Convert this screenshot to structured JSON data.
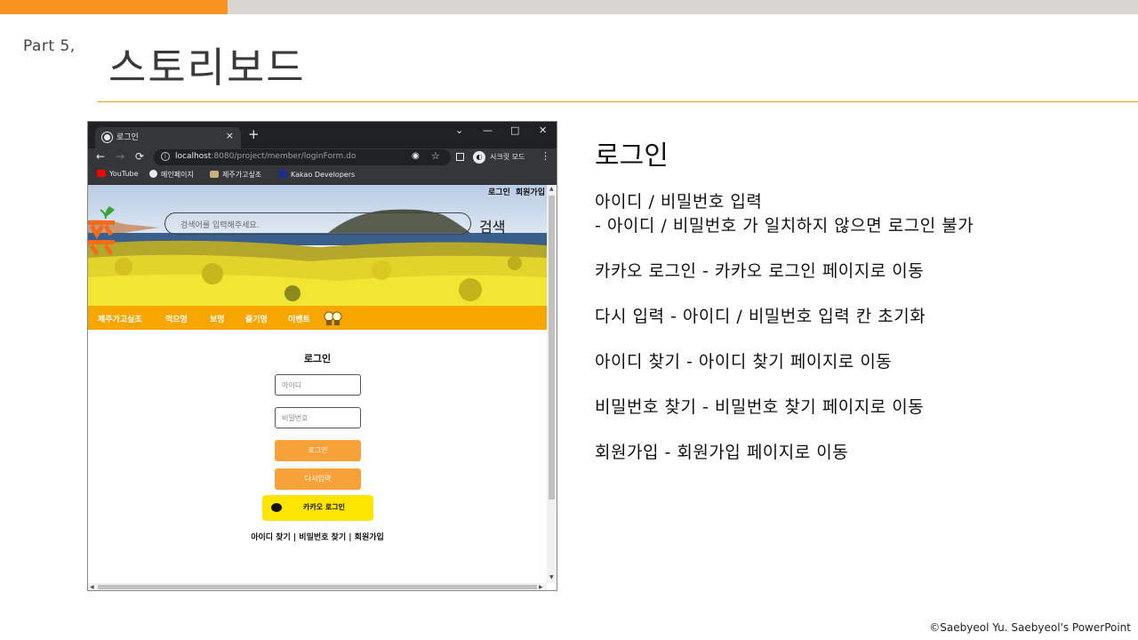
{
  "slide": {
    "part_label": "Part  5,",
    "title": "스토리보드",
    "footer": "©Saebyeol Yu. Saebyeol's PowerPoint",
    "colors": {
      "accent": "#f7931e",
      "rule": "#d8a600",
      "nav": "#f7a600",
      "kakao": "#fee500"
    }
  },
  "browser": {
    "tab_title": "로그인",
    "tab_close": "×",
    "new_tab": "+",
    "window_controls": {
      "dropdown": "⌄",
      "minimize": "—",
      "maximize": "□",
      "close": "✕"
    },
    "nav": {
      "back": "←",
      "forward": "→",
      "reload": "⟳"
    },
    "url_host": "localhost",
    "url_path": ":8080/project/member/loginForm.do",
    "incognito_label": "시크릿 모드",
    "menu": "⋮",
    "bookmarks": [
      {
        "label": "YouTube",
        "icon": "youtube-icon",
        "color": "#ff0000"
      },
      {
        "label": "메인페이지",
        "icon": "globe-icon",
        "color": "#e8eaed"
      },
      {
        "label": "제주가고싶조",
        "icon": "image-icon",
        "color": "#c8b27a"
      },
      {
        "label": "Kakao Developers",
        "icon": "kakao-k-icon",
        "color": "#1d2c8f"
      }
    ]
  },
  "site": {
    "top_links": [
      "로그인",
      "회원가입"
    ],
    "search_placeholder": "검색어를 입력해주세요.",
    "search_button": "검색",
    "nav_items": [
      "제주가고싶조",
      "먹으멍",
      "보멍",
      "즐기멍",
      "이벤트"
    ],
    "login": {
      "title": "로그인",
      "id_placeholder": "아이디",
      "pw_placeholder": "비밀번호",
      "login_button": "로그인",
      "reset_button": "다시입력",
      "kakao_button": "카카오 로그인",
      "find_links": "아이디 찾기 | 비밀번호 찾기 | 회원가입"
    }
  },
  "description": {
    "heading": "로그인",
    "lines": [
      "아이디 / 비밀번호 입력",
      " - 아이디 / 비밀번호 가 일치하지 않으면 로그인 불가",
      "카카오 로그인 - 카카오 로그인 페이지로 이동",
      "다시 입력 - 아이디 / 비밀번호 입력 칸 초기화",
      "아이디 찾기 - 아이디 찾기 페이지로 이동",
      "비밀번호 찾기 - 비밀번호 찾기 페이지로 이동",
      "회원가입 - 회원가입 페이지로 이동"
    ]
  }
}
